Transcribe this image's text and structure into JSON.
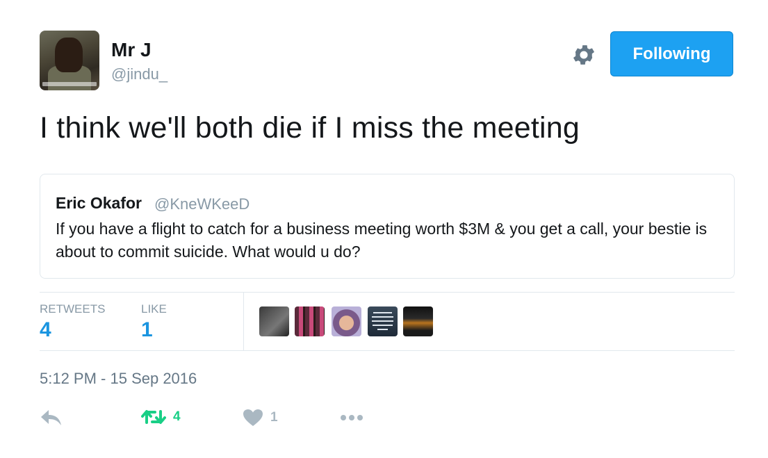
{
  "author": {
    "name": "Mr J",
    "handle": "@jindu_",
    "avatar_icon": "profile-photo"
  },
  "follow_button": {
    "label": "Following",
    "color": "#1da1f2"
  },
  "settings_icon": "gear-icon",
  "tweet": {
    "text": "I think we'll both die if I miss the meeting"
  },
  "quoted_tweet": {
    "name": "Eric Okafor",
    "handle": "@KneWKeeD",
    "text": "If you have a flight to catch for a business meeting worth $3M &  you get a call, your bestie is about to commit suicide.  What would u do?"
  },
  "stats": {
    "retweets_label": "RETWEETS",
    "retweets_value": "4",
    "likes_label": "LIKE",
    "likes_value": "1"
  },
  "likers": [
    "liker-avatar-1",
    "liker-avatar-2",
    "liker-avatar-3",
    "liker-avatar-4",
    "liker-avatar-5"
  ],
  "timestamp": "5:12 PM - 15 Sep 2016",
  "actions": {
    "reply_icon": "reply-icon",
    "retweet_icon": "retweet-icon",
    "retweet_count": "4",
    "retweet_color": "#19cf86",
    "like_icon": "heart-icon",
    "like_count": "1",
    "more_icon": "more-icon"
  }
}
